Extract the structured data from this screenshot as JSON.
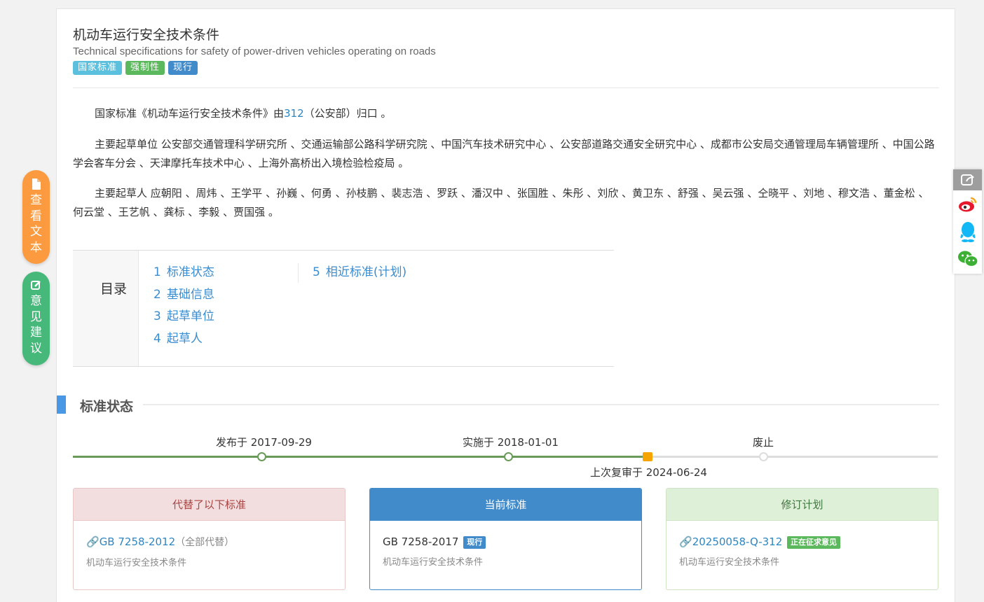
{
  "header": {
    "title_cn": "机动车运行安全技术条件",
    "title_en": "Technical specifications for safety of power-driven vehicles operating on roads",
    "badges": [
      "国家标准",
      "强制性",
      "现行"
    ]
  },
  "intro": {
    "p1_prefix": "国家标准《机动车运行安全技术条件》由",
    "p1_link": "312",
    "p1_suffix": "（公安部）归口 。",
    "p2": "主要起草单位 公安部交通管理科学研究所 、交通运输部公路科学研究院 、中国汽车技术研究中心 、公安部道路交通安全研究中心 、成都市公安局交通管理局车辆管理所 、中国公路学会客车分会 、天津摩托车技术中心 、上海外高桥出入境检验检疫局 。",
    "p3": "主要起草人 应朝阳 、周炜 、王学平 、孙巍 、何勇 、孙枝鹏 、裴志浩 、罗跃 、潘汉中 、张国胜 、朱彤 、刘欣 、黄卫东 、舒强 、吴云强 、仝晓平 、刘地 、穆文浩 、董金松 、何云堂 、王艺帆 、龚标 、李毅 、贾国强 。"
  },
  "toc": {
    "heading": "目录",
    "items": [
      {
        "num": "1",
        "label": "标准状态"
      },
      {
        "num": "2",
        "label": "基础信息"
      },
      {
        "num": "3",
        "label": "起草单位"
      },
      {
        "num": "4",
        "label": "起草人"
      },
      {
        "num": "5",
        "label": "相近标准(计划)"
      }
    ]
  },
  "status_section": {
    "title": "标准状态",
    "timeline": {
      "published": "发布于 2017-09-29",
      "implemented": "实施于 2018-01-01",
      "abolished": "废止",
      "last_review": "上次复审于 2024-06-24"
    }
  },
  "cards": {
    "replaced": {
      "header": "代替了以下标准",
      "code": "GB 7258-2012",
      "note": "（全部代替）",
      "desc": "机动车运行安全技术条件"
    },
    "current": {
      "header": "当前标准",
      "code": "GB 7258-2017",
      "tag": "现行",
      "desc": "机动车运行安全技术条件"
    },
    "revision": {
      "header": "修订计划",
      "code": "20250058-Q-312",
      "tag": "正在征求意见",
      "desc": "机动车运行安全技术条件"
    }
  },
  "float_buttons": {
    "view_text": [
      "查",
      "看",
      "文",
      "本"
    ],
    "feedback": [
      "意",
      "见",
      "建",
      "议"
    ]
  },
  "colors": {
    "accent_blue": "#428bca",
    "link": "#2e86c1",
    "orange": "#fb9a3f",
    "green": "#45b87a",
    "timeline_green": "#6a9a5a",
    "review_marker": "#f5a400"
  }
}
